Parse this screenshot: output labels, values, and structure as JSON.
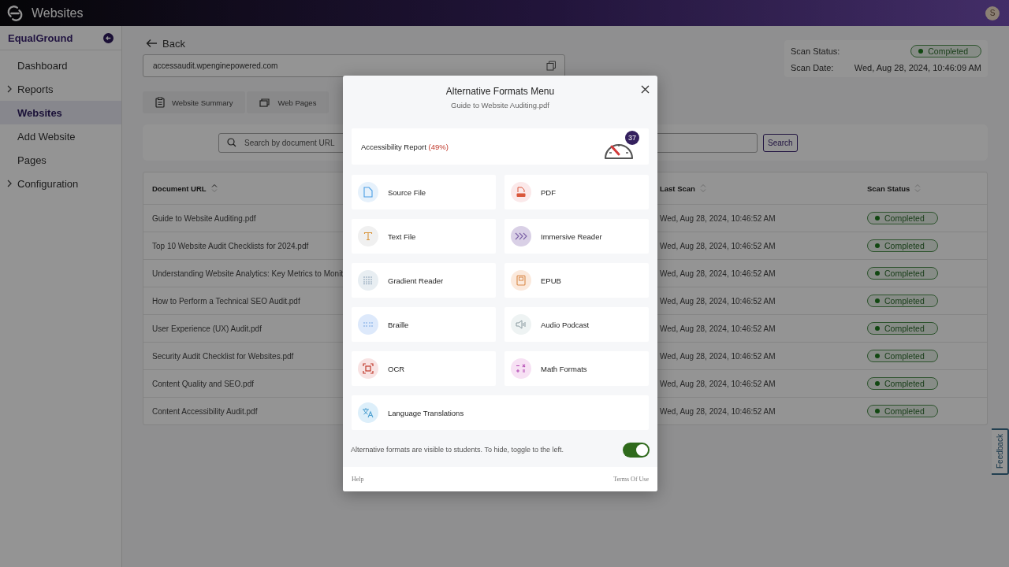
{
  "topbar": {
    "title": "Websites",
    "avatar": "S"
  },
  "sidebar": {
    "title": "EqualGround",
    "items": [
      {
        "label": "Dashboard",
        "selected": false,
        "expandable": false
      },
      {
        "label": "Reports",
        "selected": false,
        "expandable": true
      },
      {
        "label": "Websites",
        "selected": true,
        "expandable": false
      },
      {
        "label": "Add Website",
        "selected": false,
        "expandable": false
      },
      {
        "label": "Pages",
        "selected": false,
        "expandable": false
      },
      {
        "label": "Configuration",
        "selected": false,
        "expandable": true
      }
    ]
  },
  "back": "Back",
  "url_field": {
    "value": "accessaudit.wpenginepowered.com"
  },
  "scan_info": {
    "status_label": "Scan Status:",
    "status": "Completed",
    "date_label": "Scan Date:",
    "date": "Wed, Aug 28, 2024, 10:46:09 AM"
  },
  "tabs": [
    {
      "label": "Website Summary",
      "kind": "summary",
      "selected": false
    },
    {
      "label": "Web Pages",
      "kind": "pages",
      "selected": false
    }
  ],
  "search": {
    "placeholder": "Search by document URL",
    "button": "Search"
  },
  "table": {
    "columns": [
      "Document URL",
      "Last Scan",
      "Scan Status"
    ],
    "rows": [
      {
        "url": "Guide to Website Auditing.pdf",
        "last_scan": "Wed, Aug 28, 2024, 10:46:52 AM",
        "status": "Completed"
      },
      {
        "url": "Top 10 Website Audit Checklists for 2024.pdf",
        "last_scan": "Wed, Aug 28, 2024, 10:46:52 AM",
        "status": "Completed"
      },
      {
        "url": "Understanding Website Analytics: Key Metrics to Monit",
        "last_scan": "Wed, Aug 28, 2024, 10:46:52 AM",
        "status": "Completed"
      },
      {
        "url": "How to Perform a Technical SEO Audit.pdf",
        "last_scan": "Wed, Aug 28, 2024, 10:46:52 AM",
        "status": "Completed"
      },
      {
        "url": "User Experience (UX) Audit.pdf",
        "last_scan": "Wed, Aug 28, 2024, 10:46:52 AM",
        "status": "Completed"
      },
      {
        "url": "Security Audit Checklist for Websites.pdf",
        "last_scan": "Wed, Aug 28, 2024, 10:46:52 AM",
        "status": "Completed"
      },
      {
        "url": "Content Quality and SEO.pdf",
        "last_scan": "Wed, Aug 28, 2024, 10:46:52 AM",
        "status": "Completed"
      },
      {
        "url": "Content Accessibility Audit.pdf",
        "last_scan": "Wed, Aug 28, 2024, 10:46:52 AM",
        "status": "Completed"
      }
    ]
  },
  "feedback": "Feedback",
  "modal": {
    "title": "Alternative Formats Menu",
    "subtitle": "Guide to Website Auditing.pdf",
    "report": {
      "label": "Accessibility Report",
      "score": "(49%)",
      "badge": "37"
    },
    "formats": [
      {
        "label": "Source File",
        "kind": "source"
      },
      {
        "label": "PDF",
        "kind": "pdf"
      },
      {
        "label": "Text File",
        "kind": "text"
      },
      {
        "label": "Immersive Reader",
        "kind": "immersive"
      },
      {
        "label": "Gradient Reader",
        "kind": "gradient"
      },
      {
        "label": "EPUB",
        "kind": "epub"
      },
      {
        "label": "Braille",
        "kind": "braille"
      },
      {
        "label": "Audio Podcast",
        "kind": "audio"
      },
      {
        "label": "OCR",
        "kind": "ocr"
      },
      {
        "label": "Math Formats",
        "kind": "math"
      },
      {
        "label": "Language Translations",
        "kind": "language"
      }
    ],
    "visibility": {
      "text": "Alternative formats are visible to students. To hide, toggle to the left.",
      "on": true
    },
    "footer": {
      "help": "Help",
      "terms": "Terms Of Use"
    }
  }
}
